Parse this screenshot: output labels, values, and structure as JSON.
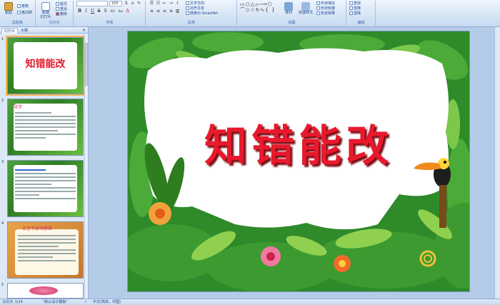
{
  "ribbon": {
    "clipboard": {
      "paste": "粘贴",
      "copy": "复制",
      "format_painter": "格式刷",
      "label": "剪贴板"
    },
    "slides": {
      "new_slide": "新建\n幻灯片",
      "layout": "版式",
      "reset": "重设",
      "delete": "删除",
      "label": "幻灯片"
    },
    "font": {
      "font_name": "",
      "font_size": "100",
      "bold": "B",
      "italic": "I",
      "underline": "U",
      "strike": "S",
      "shadow": "S",
      "spacing": "AV",
      "case": "Aa",
      "color": "A",
      "label": "字体"
    },
    "paragraph": {
      "text_direction": "文字方向",
      "align_text": "对齐文本",
      "smartart": "转换为 SmartArt",
      "label": "段落"
    },
    "drawing": {
      "arrange": "排列",
      "quick_styles": "快速样式",
      "shape_fill": "形状填充",
      "shape_outline": "形状轮廓",
      "shape_effects": "形状效果",
      "label": "绘图"
    },
    "editing": {
      "find": "查找",
      "replace": "替换",
      "select": "选择",
      "label": "编辑"
    }
  },
  "leftpane": {
    "tab_slides": "幻灯片",
    "tab_outline": "大纲",
    "close": "×",
    "thumbs": [
      {
        "num": "1",
        "title": "知错能改"
      },
      {
        "num": "2",
        "title": "导学"
      },
      {
        "num": "3",
        "title": ""
      },
      {
        "num": "4",
        "title": "古至今读书感悟"
      },
      {
        "num": "5",
        "title": ""
      }
    ]
  },
  "slide": {
    "title": "知错能改"
  },
  "status": {
    "slide_info": "幻灯片 1/14",
    "theme": "\"默认设计模板\"",
    "language": "中文(简体，中国)"
  },
  "colors": {
    "title_red": "#e8192c",
    "leaf_green": "#2f8a2a",
    "accent_orange": "#f5b651"
  }
}
